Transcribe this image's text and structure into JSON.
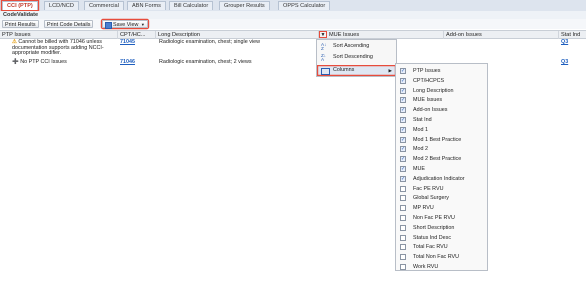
{
  "tabs": [
    "CCI (PTP)",
    "LCD/NCD",
    "Commercial",
    "ABN Forms",
    "Bill Calculator",
    "Grouper Results",
    "OPPS Calculator"
  ],
  "title": "CodeValidate",
  "toolbar": {
    "print_results": "Print Results",
    "print_code_details": "Print Code Details",
    "save_view": "Save View"
  },
  "columns": {
    "ptp": "PTP Issues",
    "cpt": "CPT/HC...",
    "long": "Long Description",
    "mue": "MUE Issues",
    "addon": "Add-on Issues",
    "stat": "Stat Ind"
  },
  "rows": [
    {
      "issue": "Cannot be billed with 71046 unless documentation supports adding NCCI-appropriate modifier.",
      "cpt": "71045",
      "desc": "Radiologic examination, chest; single view",
      "stat": "Q3"
    },
    {
      "issue": "No PTP CCI Issues",
      "cpt": "71046",
      "desc": "Radiologic examination, chest; 2 views",
      "stat": "Q3"
    }
  ],
  "menu": {
    "sort_asc": "Sort Ascending",
    "sort_desc": "Sort Descending",
    "columns": "Columns"
  },
  "column_options": [
    {
      "label": "PTP Issues",
      "checked": true
    },
    {
      "label": "CPT/HCPCS",
      "checked": true
    },
    {
      "label": "Long Description",
      "checked": true
    },
    {
      "label": "MUE Issues",
      "checked": true
    },
    {
      "label": "Add-on Issues",
      "checked": true
    },
    {
      "label": "Stat Ind",
      "checked": true
    },
    {
      "label": "Mod 1",
      "checked": true
    },
    {
      "label": "Mod 1 Best Practice",
      "checked": true
    },
    {
      "label": "Mod 2",
      "checked": true
    },
    {
      "label": "Mod 2 Best Practice",
      "checked": true
    },
    {
      "label": "MUE",
      "checked": true
    },
    {
      "label": "Adjudication Indicator",
      "checked": true
    },
    {
      "label": "Fac PE RVU",
      "checked": false
    },
    {
      "label": "Global Surgery",
      "checked": false
    },
    {
      "label": "MP RVU",
      "checked": false
    },
    {
      "label": "Non Fac PE RVU",
      "checked": false
    },
    {
      "label": "Short Description",
      "checked": false
    },
    {
      "label": "Status Ind Desc",
      "checked": false
    },
    {
      "label": "Total Fac RVU",
      "checked": false
    },
    {
      "label": "Total Non Fac RVU",
      "checked": false
    },
    {
      "label": "Work RVU",
      "checked": false
    }
  ],
  "colors": {
    "accent": "#e74c3c",
    "link": "#1f5fbf",
    "warning": "#e6a117",
    "ok": "#2e9b3a"
  }
}
